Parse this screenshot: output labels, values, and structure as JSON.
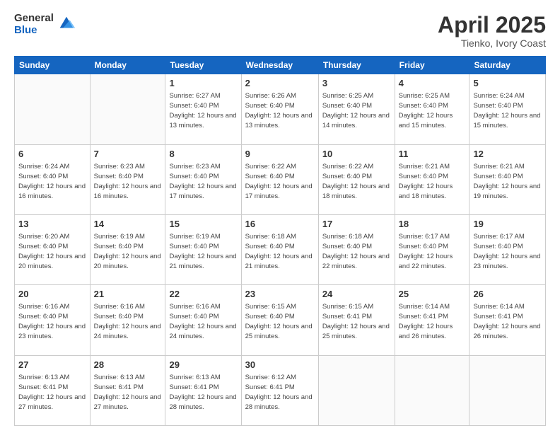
{
  "logo": {
    "general": "General",
    "blue": "Blue"
  },
  "header": {
    "title": "April 2025",
    "subtitle": "Tienko, Ivory Coast"
  },
  "weekdays": [
    "Sunday",
    "Monday",
    "Tuesday",
    "Wednesday",
    "Thursday",
    "Friday",
    "Saturday"
  ],
  "weeks": [
    [
      {
        "day": "",
        "info": ""
      },
      {
        "day": "",
        "info": ""
      },
      {
        "day": "1",
        "info": "Sunrise: 6:27 AM\nSunset: 6:40 PM\nDaylight: 12 hours and 13 minutes."
      },
      {
        "day": "2",
        "info": "Sunrise: 6:26 AM\nSunset: 6:40 PM\nDaylight: 12 hours and 13 minutes."
      },
      {
        "day": "3",
        "info": "Sunrise: 6:25 AM\nSunset: 6:40 PM\nDaylight: 12 hours and 14 minutes."
      },
      {
        "day": "4",
        "info": "Sunrise: 6:25 AM\nSunset: 6:40 PM\nDaylight: 12 hours and 15 minutes."
      },
      {
        "day": "5",
        "info": "Sunrise: 6:24 AM\nSunset: 6:40 PM\nDaylight: 12 hours and 15 minutes."
      }
    ],
    [
      {
        "day": "6",
        "info": "Sunrise: 6:24 AM\nSunset: 6:40 PM\nDaylight: 12 hours and 16 minutes."
      },
      {
        "day": "7",
        "info": "Sunrise: 6:23 AM\nSunset: 6:40 PM\nDaylight: 12 hours and 16 minutes."
      },
      {
        "day": "8",
        "info": "Sunrise: 6:23 AM\nSunset: 6:40 PM\nDaylight: 12 hours and 17 minutes."
      },
      {
        "day": "9",
        "info": "Sunrise: 6:22 AM\nSunset: 6:40 PM\nDaylight: 12 hours and 17 minutes."
      },
      {
        "day": "10",
        "info": "Sunrise: 6:22 AM\nSunset: 6:40 PM\nDaylight: 12 hours and 18 minutes."
      },
      {
        "day": "11",
        "info": "Sunrise: 6:21 AM\nSunset: 6:40 PM\nDaylight: 12 hours and 18 minutes."
      },
      {
        "day": "12",
        "info": "Sunrise: 6:21 AM\nSunset: 6:40 PM\nDaylight: 12 hours and 19 minutes."
      }
    ],
    [
      {
        "day": "13",
        "info": "Sunrise: 6:20 AM\nSunset: 6:40 PM\nDaylight: 12 hours and 20 minutes."
      },
      {
        "day": "14",
        "info": "Sunrise: 6:19 AM\nSunset: 6:40 PM\nDaylight: 12 hours and 20 minutes."
      },
      {
        "day": "15",
        "info": "Sunrise: 6:19 AM\nSunset: 6:40 PM\nDaylight: 12 hours and 21 minutes."
      },
      {
        "day": "16",
        "info": "Sunrise: 6:18 AM\nSunset: 6:40 PM\nDaylight: 12 hours and 21 minutes."
      },
      {
        "day": "17",
        "info": "Sunrise: 6:18 AM\nSunset: 6:40 PM\nDaylight: 12 hours and 22 minutes."
      },
      {
        "day": "18",
        "info": "Sunrise: 6:17 AM\nSunset: 6:40 PM\nDaylight: 12 hours and 22 minutes."
      },
      {
        "day": "19",
        "info": "Sunrise: 6:17 AM\nSunset: 6:40 PM\nDaylight: 12 hours and 23 minutes."
      }
    ],
    [
      {
        "day": "20",
        "info": "Sunrise: 6:16 AM\nSunset: 6:40 PM\nDaylight: 12 hours and 23 minutes."
      },
      {
        "day": "21",
        "info": "Sunrise: 6:16 AM\nSunset: 6:40 PM\nDaylight: 12 hours and 24 minutes."
      },
      {
        "day": "22",
        "info": "Sunrise: 6:16 AM\nSunset: 6:40 PM\nDaylight: 12 hours and 24 minutes."
      },
      {
        "day": "23",
        "info": "Sunrise: 6:15 AM\nSunset: 6:40 PM\nDaylight: 12 hours and 25 minutes."
      },
      {
        "day": "24",
        "info": "Sunrise: 6:15 AM\nSunset: 6:41 PM\nDaylight: 12 hours and 25 minutes."
      },
      {
        "day": "25",
        "info": "Sunrise: 6:14 AM\nSunset: 6:41 PM\nDaylight: 12 hours and 26 minutes."
      },
      {
        "day": "26",
        "info": "Sunrise: 6:14 AM\nSunset: 6:41 PM\nDaylight: 12 hours and 26 minutes."
      }
    ],
    [
      {
        "day": "27",
        "info": "Sunrise: 6:13 AM\nSunset: 6:41 PM\nDaylight: 12 hours and 27 minutes."
      },
      {
        "day": "28",
        "info": "Sunrise: 6:13 AM\nSunset: 6:41 PM\nDaylight: 12 hours and 27 minutes."
      },
      {
        "day": "29",
        "info": "Sunrise: 6:13 AM\nSunset: 6:41 PM\nDaylight: 12 hours and 28 minutes."
      },
      {
        "day": "30",
        "info": "Sunrise: 6:12 AM\nSunset: 6:41 PM\nDaylight: 12 hours and 28 minutes."
      },
      {
        "day": "",
        "info": ""
      },
      {
        "day": "",
        "info": ""
      },
      {
        "day": "",
        "info": ""
      }
    ]
  ]
}
